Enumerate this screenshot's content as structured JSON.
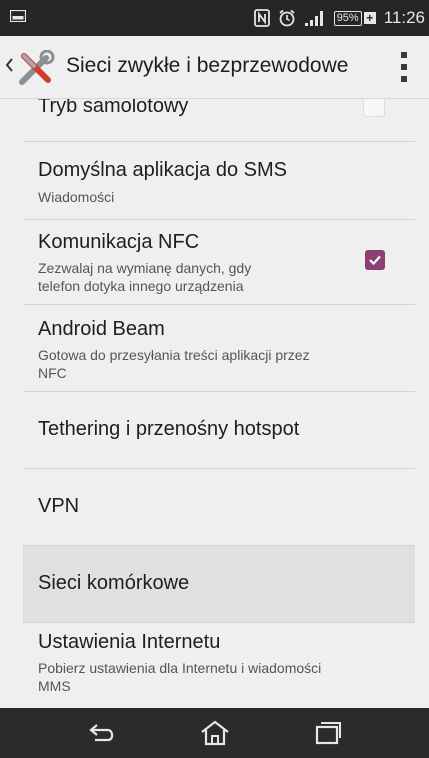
{
  "status_bar": {
    "battery_percent": "95%",
    "charging_symbol": "+",
    "time": "11:26",
    "icons": [
      "picture-notification-icon",
      "nfc-icon",
      "alarm-icon",
      "signal-icon",
      "battery-icon"
    ]
  },
  "action_bar": {
    "title": "Sieci zwykłe i bezprzewodowe",
    "icons": [
      "back-chevron-icon",
      "tools-icon",
      "overflow-menu-icon"
    ]
  },
  "settings": {
    "items": [
      {
        "title": "Tryb samolotowy",
        "checkbox": "unchecked"
      },
      {
        "title": "Domyślna aplikacja do SMS",
        "subtitle": "Wiadomości"
      },
      {
        "title": "Komunikacja NFC",
        "subtitle_line1": "Zezwalaj na wymianę danych, gdy",
        "subtitle_line2": "telefon dotyka innego urządzenia",
        "checkbox": "checked"
      },
      {
        "title": "Android Beam",
        "subtitle_line1": "Gotowa do przesyłania treści aplikacji przez",
        "subtitle_line2": "NFC"
      },
      {
        "title": "Tethering i przenośny hotspot"
      },
      {
        "title": "VPN"
      },
      {
        "title": "Sieci komórkowe",
        "state": "pressed"
      },
      {
        "title": "Ustawienia Internetu",
        "subtitle_line1": "Pobierz ustawienia dla Internetu i wiadomości",
        "subtitle_line2": "MMS"
      }
    ]
  },
  "nav_bar": {
    "icons": [
      "back-icon",
      "home-icon",
      "recent-apps-icon"
    ]
  },
  "colors": {
    "accent": "#8a3f76",
    "status_bar_bg": "#262626",
    "nav_bar_bg": "#2b2b2b",
    "background": "#efefef"
  }
}
